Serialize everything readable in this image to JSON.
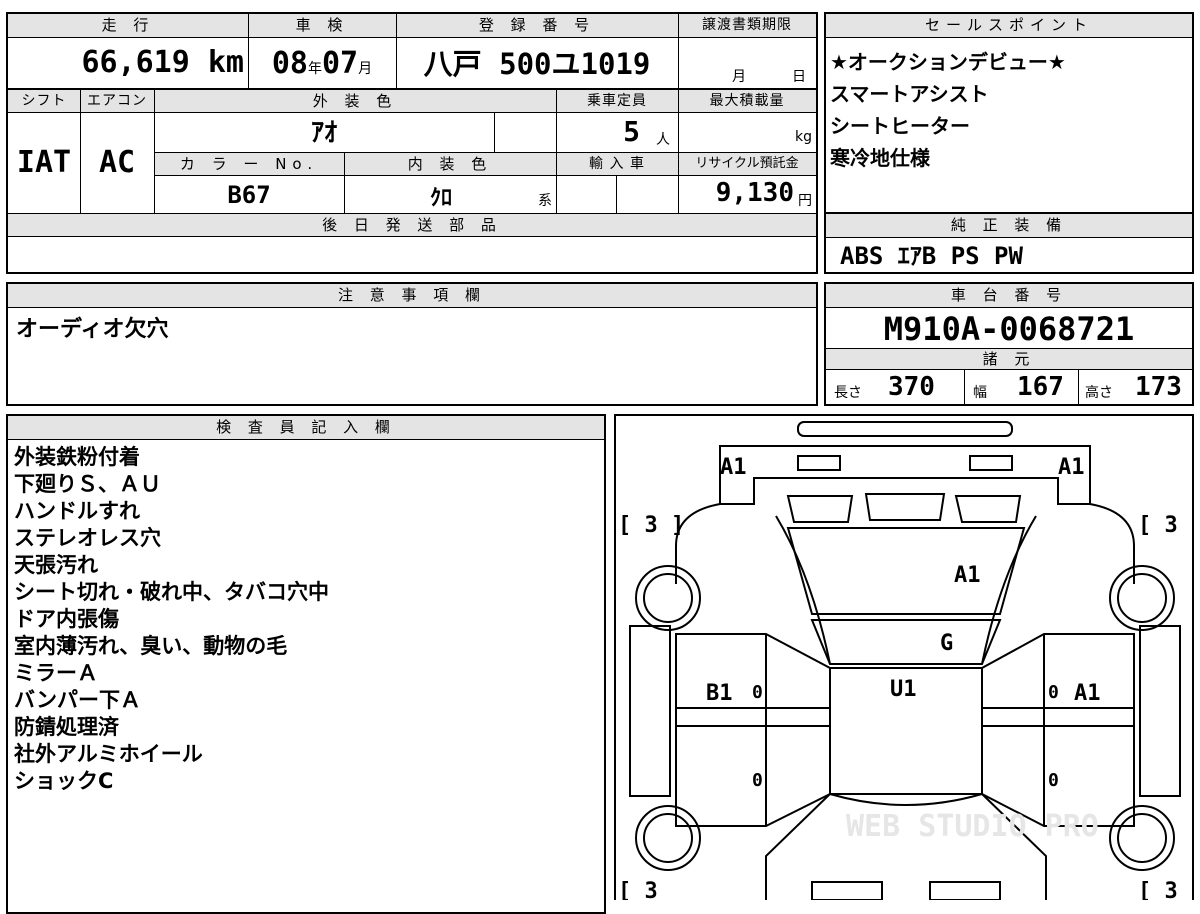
{
  "vehicle": {
    "mileage_label": "走 行",
    "mileage_value": "66,619",
    "mileage_unit": "km",
    "inspection_label": "車 検",
    "inspection_year": "08",
    "year_unit": "年",
    "inspection_month": "07",
    "month_unit": "月",
    "registration_label": "登 録 番 号",
    "registration_value": "八戸 500ユ1019",
    "transfer_deadline_label": "譲渡書類期限",
    "transfer_month_unit": "月",
    "transfer_day_unit": "日",
    "shift_label": "シフト",
    "shift_value": "IAT",
    "aircon_label": "エアコン",
    "aircon_value": "AC",
    "exterior_color_label": "外 装 色",
    "exterior_color_value": "ｱｵ",
    "capacity_label": "乗車定員",
    "capacity_value": "5",
    "capacity_unit": "人",
    "max_load_label": "最大積載量",
    "max_load_unit": "kg",
    "color_no_label": "カ ラ ー No.",
    "color_no_value": "B67",
    "interior_color_label": "内 装 色",
    "interior_color_value": "ｸﾛ",
    "interior_suffix": "系",
    "import_label": "輸 入 車",
    "recycle_label": "リサイクル預託金",
    "recycle_value": "9,130",
    "recycle_unit": "円",
    "later_parts_label": "後 日 発 送 部 品"
  },
  "sales_points": {
    "label": "セールスポイント",
    "items": [
      "★オークションデビュー★",
      "スマートアシスト",
      "シートヒーター",
      "寒冷地仕様"
    ]
  },
  "standard_equipment": {
    "label": "純 正 装 備",
    "value": "ABS ｴｱB PS PW"
  },
  "notes": {
    "label": "注 意 事 項 欄",
    "value": "オーディオ欠穴"
  },
  "chassis": {
    "label": "車 台 番 号",
    "value": "M910A-0068721",
    "specs_label": "諸 元",
    "length_label": "長さ",
    "length_value": "370",
    "width_label": "幅",
    "width_value": "167",
    "height_label": "高さ",
    "height_value": "173"
  },
  "inspector": {
    "label": "検 査 員 記 入 欄",
    "items": [
      "外装鉄粉付着",
      "下廻りＳ、ＡＵ",
      "ハンドルすれ",
      "ステレオレス穴",
      "天張汚れ",
      "シート切れ・破れ中、タバコ穴中",
      "ドア内張傷",
      "室内薄汚れ、臭い、動物の毛",
      "ミラーＡ",
      "バンパー下Ａ",
      "防錆処理済",
      "社外アルミホイール",
      "ショックC"
    ]
  },
  "diagram": {
    "front_left": "A1",
    "front_right": "A1",
    "tire_fl": "[ 3 ]",
    "tire_fr": "[ 3 ]",
    "tire_rl": "[ 3",
    "tire_rr": "[ 3",
    "hood": "A1",
    "windshield": "G",
    "roof": "U1",
    "left_door": "B1",
    "right_door": "A1",
    "door_marks": [
      "0",
      "0",
      "0",
      "0"
    ],
    "watermark": "WEB STUDIO PRO"
  }
}
